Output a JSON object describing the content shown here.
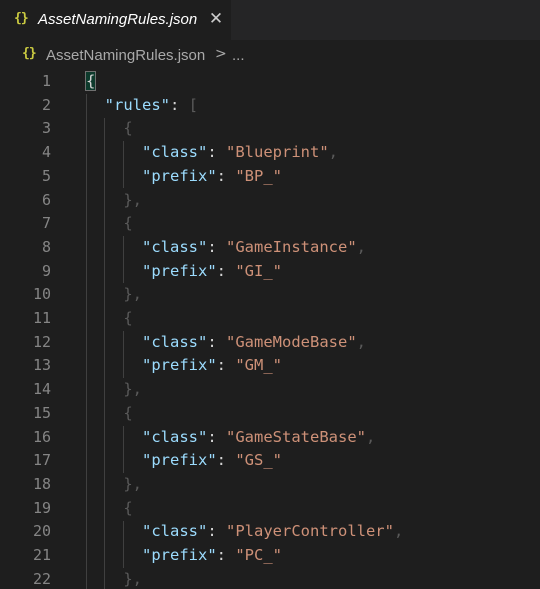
{
  "tab": {
    "icon": "{}",
    "title": "AssetNamingRules.json",
    "close": "✕"
  },
  "breadcrumb": {
    "icon": "{}",
    "file": "AssetNamingRules.json",
    "separator": ">",
    "ellipsis": "..."
  },
  "editor": {
    "line_numbers": [
      "1",
      "2",
      "3",
      "4",
      "5",
      "6",
      "7",
      "8",
      "9",
      "10",
      "11",
      "12",
      "13",
      "14",
      "15",
      "16",
      "17",
      "18",
      "19",
      "20",
      "21",
      "22"
    ],
    "open_brace": "{",
    "rules_key": "\"rules\"",
    "rules_array_open": "[",
    "colon": ": ",
    "comma": ",",
    "obj_open": "{",
    "obj_close": "},",
    "class_key": "\"class\"",
    "prefix_key": "\"prefix\"",
    "entries": [
      {
        "class": "\"Blueprint\"",
        "prefix": "\"BP_\""
      },
      {
        "class": "\"GameInstance\"",
        "prefix": "\"GI_\""
      },
      {
        "class": "\"GameModeBase\"",
        "prefix": "\"GM_\""
      },
      {
        "class": "\"GameStateBase\"",
        "prefix": "\"GS_\""
      },
      {
        "class": "\"PlayerController\"",
        "prefix": "\"PC_\""
      }
    ]
  },
  "colors": {
    "background": "#1e1e1e",
    "tabbar": "#252526",
    "json_icon": "#cbcb41",
    "key": "#9cdcfe",
    "string": "#ce9178",
    "line_number": "#858585"
  }
}
